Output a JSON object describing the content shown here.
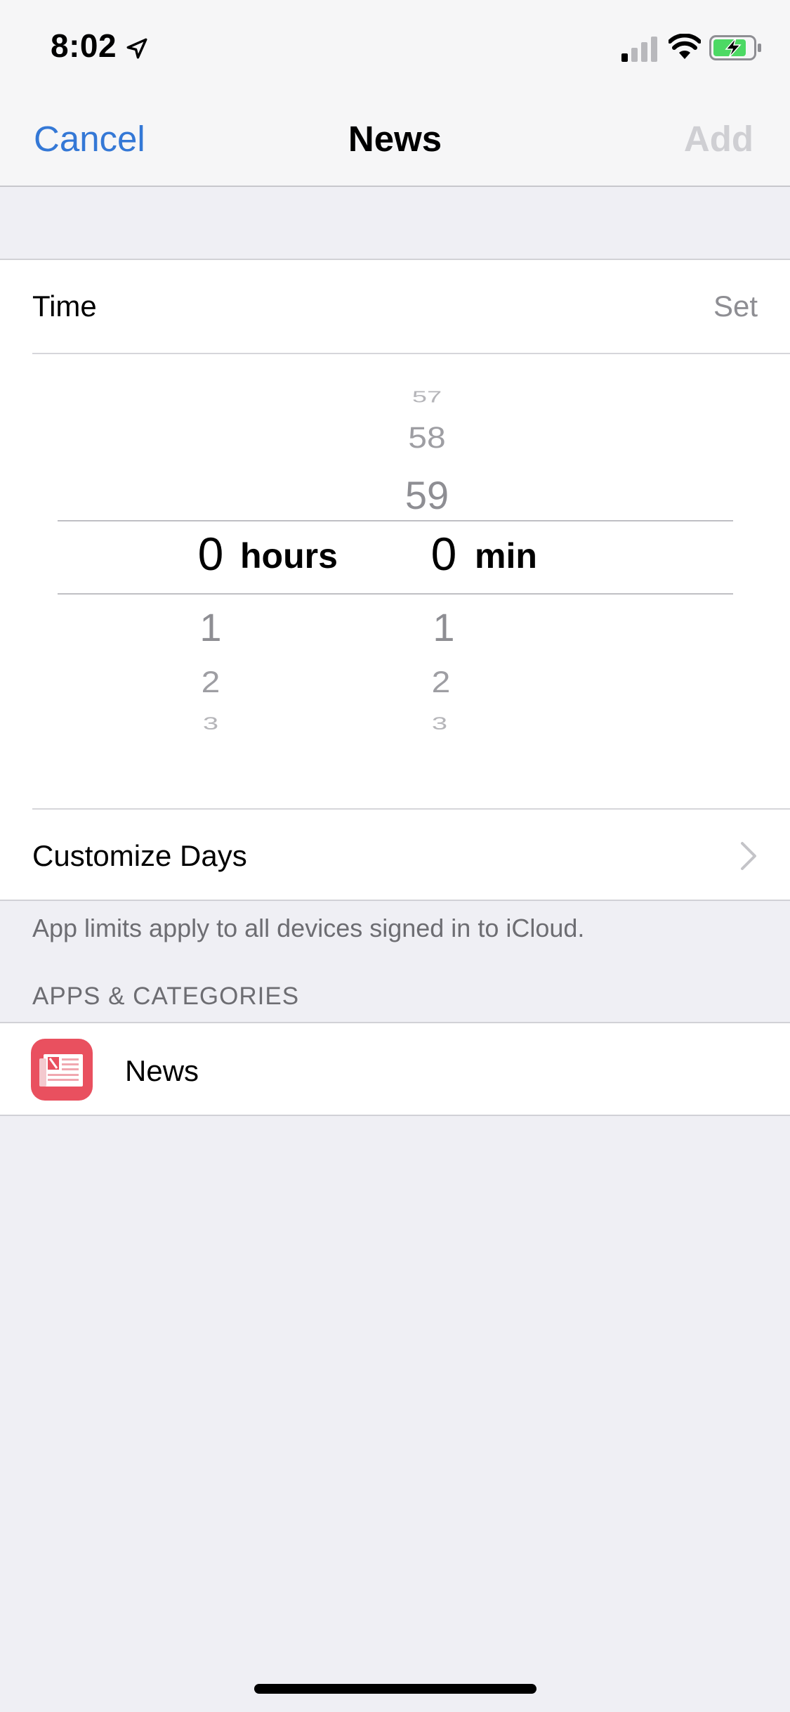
{
  "status": {
    "time": "8:02"
  },
  "nav": {
    "cancel": "Cancel",
    "title": "News",
    "add": "Add"
  },
  "time_row": {
    "label": "Time",
    "value": "Set"
  },
  "picker": {
    "hours": {
      "above": [],
      "selected": "0",
      "below": [
        "1",
        "2",
        "3"
      ],
      "unit": "hours"
    },
    "minutes": {
      "above": [
        "57",
        "58",
        "59"
      ],
      "selected": "0",
      "below": [
        "1",
        "2",
        "3"
      ],
      "unit": "min"
    }
  },
  "customize_row": {
    "label": "Customize Days"
  },
  "footer_note": "App limits apply to all devices signed in to iCloud.",
  "apps_section": {
    "header": "APPS & CATEGORIES",
    "items": [
      {
        "name": "News",
        "icon": "news-app-icon"
      }
    ]
  },
  "colors": {
    "accent": "#3478d6",
    "disabled": "#cfcfd3",
    "news_icon": "#e9505f",
    "battery_fill": "#4cd964"
  }
}
